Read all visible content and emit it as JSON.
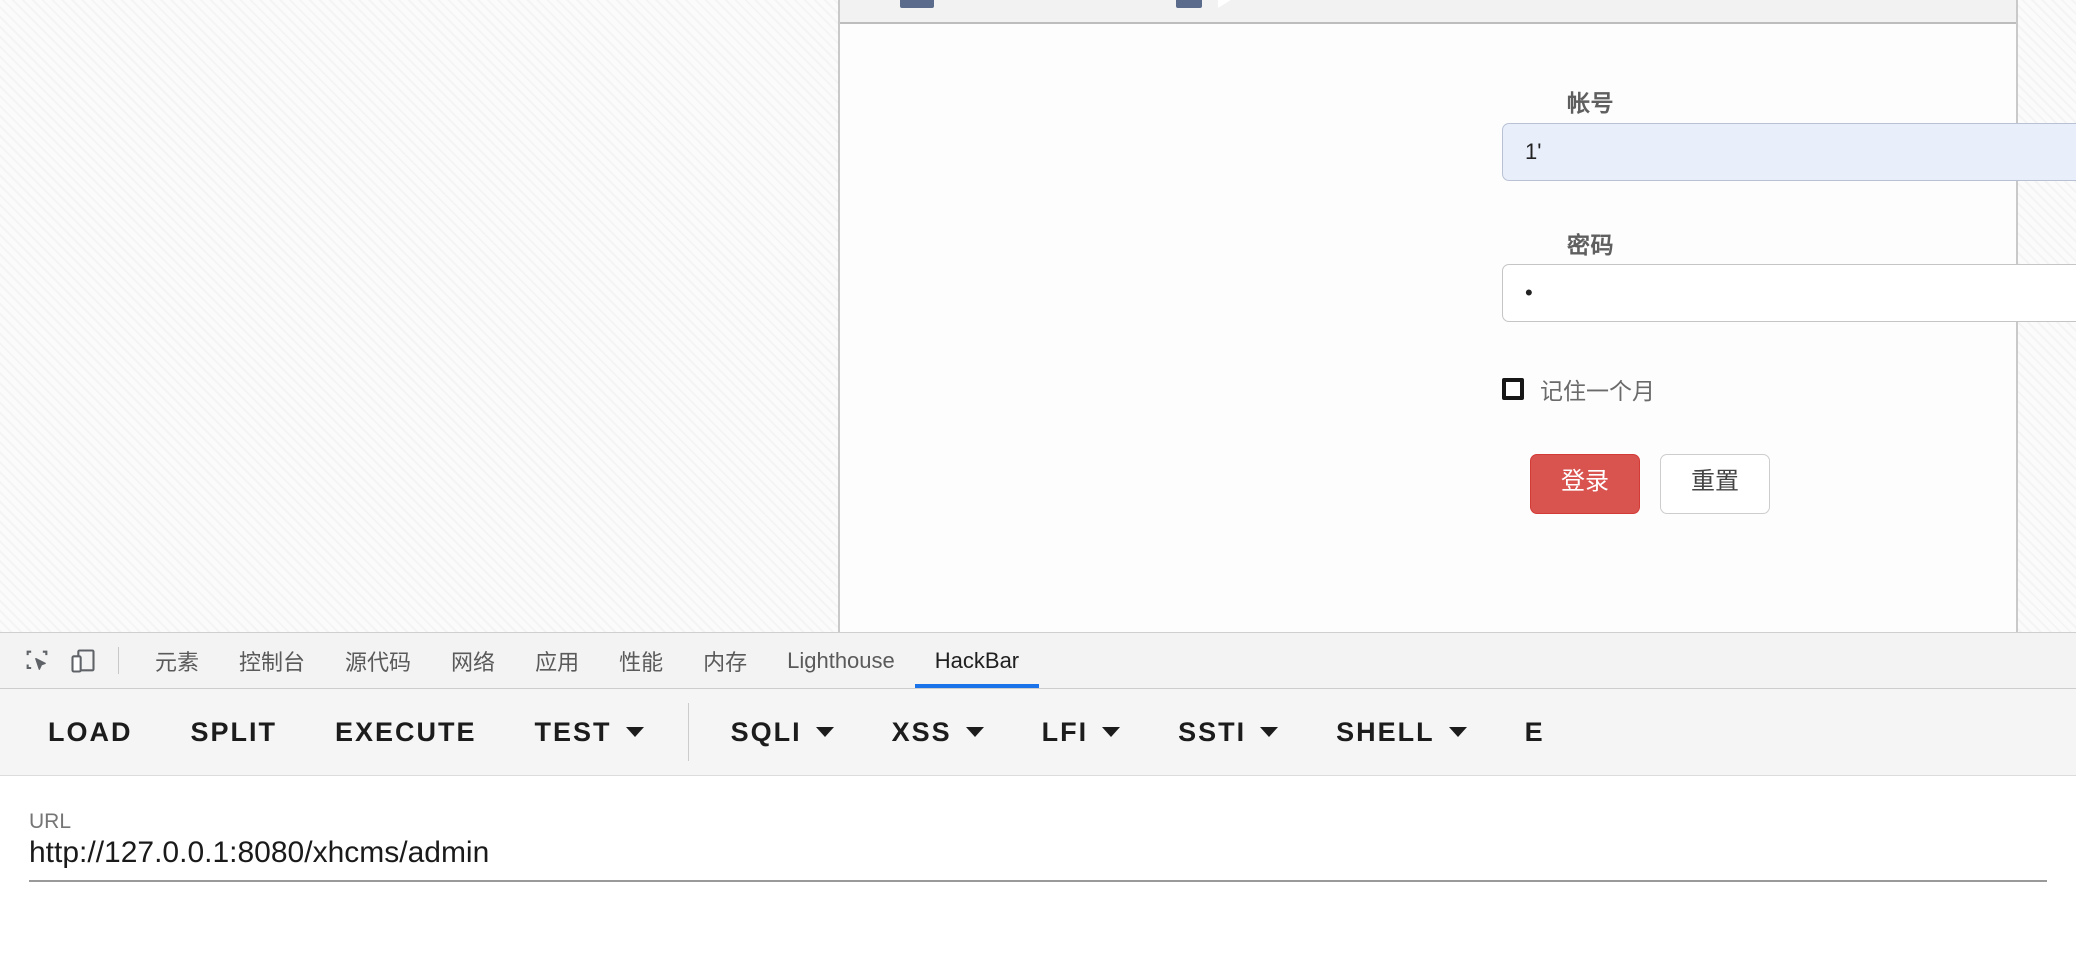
{
  "page": {
    "form": {
      "account_label": "帐号",
      "account_value": "1'",
      "password_label": "密码",
      "password_value": "•",
      "remember_label": "记住一个月",
      "login_button": "登录",
      "reset_button": "重置"
    }
  },
  "devtools": {
    "icons": {
      "inspect": "inspect-element-icon",
      "device": "device-toolbar-icon"
    },
    "tabs": [
      {
        "label": "元素",
        "active": false
      },
      {
        "label": "控制台",
        "active": false
      },
      {
        "label": "源代码",
        "active": false
      },
      {
        "label": "网络",
        "active": false
      },
      {
        "label": "应用",
        "active": false
      },
      {
        "label": "性能",
        "active": false
      },
      {
        "label": "内存",
        "active": false
      },
      {
        "label": "Lighthouse",
        "active": false
      },
      {
        "label": "HackBar",
        "active": true
      }
    ],
    "active_tab_color": "#1a73e8"
  },
  "hackbar": {
    "buttons": [
      {
        "label": "LOAD",
        "dropdown": false,
        "divider_after": false
      },
      {
        "label": "SPLIT",
        "dropdown": false,
        "divider_after": false
      },
      {
        "label": "EXECUTE",
        "dropdown": false,
        "divider_after": false
      },
      {
        "label": "TEST",
        "dropdown": true,
        "divider_after": true
      },
      {
        "label": "SQLI",
        "dropdown": true,
        "divider_after": false
      },
      {
        "label": "XSS",
        "dropdown": true,
        "divider_after": false
      },
      {
        "label": "LFI",
        "dropdown": true,
        "divider_after": false
      },
      {
        "label": "SSTI",
        "dropdown": true,
        "divider_after": false
      },
      {
        "label": "SHELL",
        "dropdown": true,
        "divider_after": false
      },
      {
        "label": "E",
        "dropdown": false,
        "divider_after": false
      }
    ],
    "url_label": "URL",
    "url_value": "http://127.0.0.1:8080/xhcms/admin"
  }
}
